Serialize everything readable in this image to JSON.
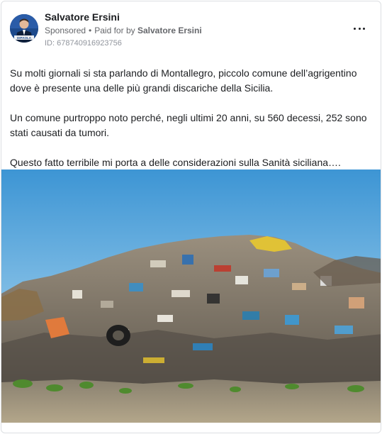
{
  "post": {
    "author": "Salvatore Ersini",
    "sponsored_label": "Sponsored",
    "separator": "•",
    "paid_for_prefix": "Paid for by",
    "paid_for_name": "Salvatore Ersini",
    "ad_id": "ID: 678740916923756",
    "avatar_caption": "DIPAOLA",
    "paragraphs": [
      "Su molti giornali si sta parlando di Montallegro, piccolo comune dell’agrigentino dove è presente una delle più grandi discariche della Sicilia.",
      "Un comune purtroppo noto perché, negli ultimi 20 anni, su 560 decessi, 252 sono stati causati da tumori.",
      "Questo fatto terribile mi porta a delle considerazioni sulla Sanità siciliana…."
    ]
  },
  "icons": {
    "more_options": "more-horizontal-icon"
  },
  "colors": {
    "name_text": "#1c1e21",
    "meta_text": "#65676b",
    "id_text": "#90949c",
    "border": "#dddfe2",
    "sky_top": "#4a9fd8",
    "sky_bottom": "#bcdcf0"
  }
}
